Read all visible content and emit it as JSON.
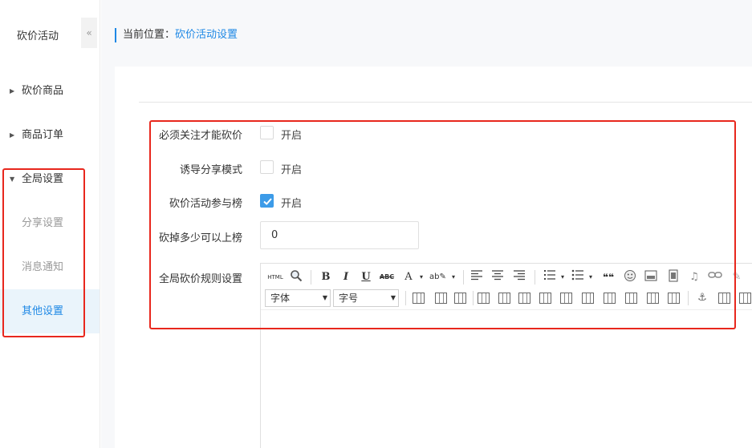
{
  "sidebar": {
    "title": "砍价活动",
    "collapse_glyph": "«",
    "items": [
      {
        "label": "砍价商品",
        "arrow": "▶"
      },
      {
        "label": "商品订单",
        "arrow": "▶"
      },
      {
        "label": "全局设置",
        "arrow": "▼"
      }
    ],
    "sub_items": [
      {
        "label": "分享设置"
      },
      {
        "label": "消息通知"
      },
      {
        "label": "其他设置"
      }
    ]
  },
  "breadcrumb": {
    "prefix": "当前位置：",
    "current": "砍价活动设置"
  },
  "form": {
    "must_follow": {
      "label": "必须关注才能砍价",
      "option": "开启",
      "checked": false
    },
    "share_mode": {
      "label": "诱导分享模式",
      "option": "开启",
      "checked": false
    },
    "ranking": {
      "label": "砍价活动参与榜",
      "option": "开启",
      "checked": true
    },
    "rank_threshold": {
      "label": "砍掉多少可以上榜",
      "value": "0"
    },
    "rules": {
      "label": "全局砍价规则设置"
    }
  },
  "editor": {
    "font_family_placeholder": "字体",
    "font_size_placeholder": "字号",
    "html_label": "HTML",
    "bold": "B",
    "italic": "I",
    "underline": "U",
    "strike": "ABC",
    "font_color": "A",
    "quote": "❝❝"
  },
  "colors": {
    "accent": "#1e88e5",
    "highlight_box": "#e8271d",
    "checkbox_checked": "#3c9be8"
  }
}
